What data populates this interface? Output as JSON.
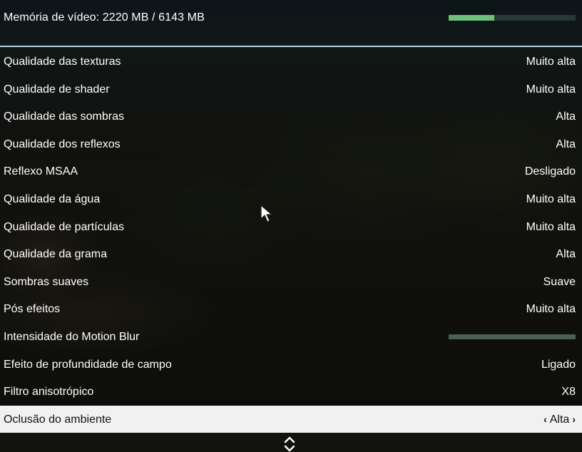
{
  "header": {
    "vram_label": "Memória de vídeo: 2220 MB / 6143 MB",
    "vram_usage_fraction": 0.361
  },
  "settings": [
    {
      "label": "Qualidade das texturas",
      "value": "Muito alta"
    },
    {
      "label": "Qualidade de shader",
      "value": "Muito alta"
    },
    {
      "label": "Qualidade das sombras",
      "value": "Alta"
    },
    {
      "label": "Qualidade dos reflexos",
      "value": "Alta"
    },
    {
      "label": "Reflexo MSAA",
      "value": "Desligado"
    },
    {
      "label": "Qualidade da água",
      "value": "Muito alta"
    },
    {
      "label": "Qualidade de partículas",
      "value": "Muito alta"
    },
    {
      "label": "Qualidade da grama",
      "value": "Alta"
    },
    {
      "label": "Sombras suaves",
      "value": "Suave"
    },
    {
      "label": "Pós efeitos",
      "value": "Muito alta"
    },
    {
      "label": "Intensidade do Motion Blur",
      "slider_level": 0
    },
    {
      "label": "Efeito de profundidade de campo",
      "value": "Ligado"
    },
    {
      "label": "Filtro anisotrópico",
      "value": "X8"
    },
    {
      "label": "Oclusão do ambiente",
      "value": "Alta",
      "selected": true
    }
  ],
  "icons": {
    "scroll": "chevron-up-down-icon",
    "cursor": "mouse-cursor-icon",
    "prev": "chevron-left-icon",
    "next": "chevron-right-icon"
  },
  "colors": {
    "vram_fill": "#6dc07a",
    "header_line": "#a9d3d9",
    "selected_row": "#f1f1f1"
  }
}
